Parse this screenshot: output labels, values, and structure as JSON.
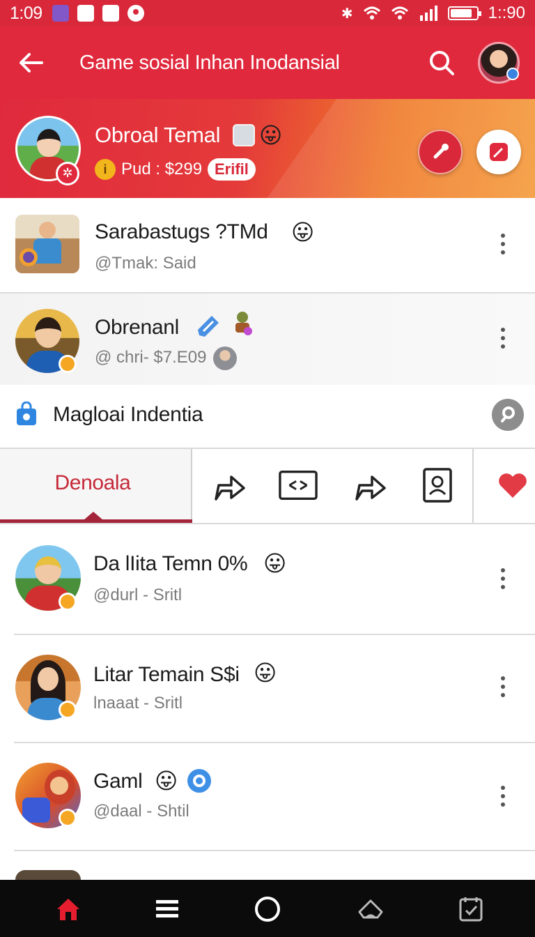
{
  "status_bar": {
    "time": "1:09",
    "clock": "1::90",
    "notification_icons": [
      "app-notification-icon",
      "image-notification-icon",
      "chat-notification-icon",
      "circle-notification-icon"
    ],
    "system_icons": [
      "bluetooth-icon",
      "wifi-icon",
      "wifi-icon",
      "signal-icon",
      "battery-icon"
    ]
  },
  "app_bar": {
    "title": "Game sosial Inhan Inodansial",
    "icons": [
      "back-arrow-icon",
      "search-icon",
      "profile-avatar"
    ]
  },
  "hero": {
    "name": "Obroal Temal",
    "emoji": "😛",
    "points": "Pud : $299",
    "edit_label": "Erifil",
    "badge_glyph": "✲",
    "coin_glyph": "i",
    "buttons": [
      "mic-icon",
      "compose-icon"
    ]
  },
  "contacts_top": [
    {
      "name": "Sarabastugs ?TMd",
      "emoji": "😛",
      "handle": "@Tmak: Said"
    },
    {
      "name": "Obrenanl",
      "emoji": "",
      "handle": "@ chri- $7.E09"
    }
  ],
  "section": {
    "title": "Magloai Indentia",
    "icons": [
      "shopping-bag-icon",
      "key-icon"
    ]
  },
  "tabs": {
    "active_label": "Denoala",
    "icons": [
      "share-arrow-icon",
      "shuffle-box-icon",
      "share-arrow-icon",
      "contact-card-icon",
      "heart-icon"
    ]
  },
  "contacts": [
    {
      "name": "Da lIita Temn  0%",
      "emoji": "😛",
      "handle": "@durl - Sritl"
    },
    {
      "name": "Litar Temain  S$i",
      "emoji": "😛",
      "handle": "lnaaat - Sritl"
    },
    {
      "name": "Gaml",
      "emoji": "😛",
      "handle": "@daal - Shtil"
    }
  ],
  "bottom_nav": {
    "items": [
      "home-icon",
      "menu-icon",
      "circle-icon",
      "cloud-up-icon",
      "calendar-check-icon"
    ],
    "active": "home-icon"
  },
  "colors": {
    "primary": "#e0293d",
    "accent_orange": "#f07a2a",
    "active_tab_text": "#c62838",
    "heart": "#e23b46",
    "nav_bg": "#0b0b0b"
  }
}
